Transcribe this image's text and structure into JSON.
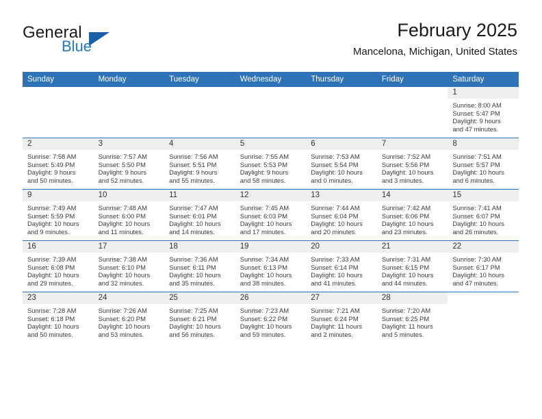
{
  "brand": {
    "name_part1": "General",
    "name_part2": "Blue",
    "logo_icon": "blue-triangle-icon"
  },
  "header": {
    "title": "February 2025",
    "location": "Mancelona, Michigan, United States"
  },
  "colors": {
    "header_blue": "#2E72B8",
    "daynum_band": "#EFEFEF",
    "brand_blue": "#2277C8",
    "separator": "#2E72B8"
  },
  "calendar": {
    "weekday_headers": [
      "Sunday",
      "Monday",
      "Tuesday",
      "Wednesday",
      "Thursday",
      "Friday",
      "Saturday"
    ],
    "weeks": [
      [
        {
          "day": "",
          "sunrise": "",
          "sunset": "",
          "daylight_line1": "",
          "daylight_line2": "",
          "empty": true
        },
        {
          "day": "",
          "sunrise": "",
          "sunset": "",
          "daylight_line1": "",
          "daylight_line2": "",
          "empty": true
        },
        {
          "day": "",
          "sunrise": "",
          "sunset": "",
          "daylight_line1": "",
          "daylight_line2": "",
          "empty": true
        },
        {
          "day": "",
          "sunrise": "",
          "sunset": "",
          "daylight_line1": "",
          "daylight_line2": "",
          "empty": true
        },
        {
          "day": "",
          "sunrise": "",
          "sunset": "",
          "daylight_line1": "",
          "daylight_line2": "",
          "empty": true
        },
        {
          "day": "",
          "sunrise": "",
          "sunset": "",
          "daylight_line1": "",
          "daylight_line2": "",
          "empty": true
        },
        {
          "day": "1",
          "sunrise": "Sunrise: 8:00 AM",
          "sunset": "Sunset: 5:47 PM",
          "daylight_line1": "Daylight: 9 hours",
          "daylight_line2": "and 47 minutes.",
          "empty": false
        }
      ],
      [
        {
          "day": "2",
          "sunrise": "Sunrise: 7:58 AM",
          "sunset": "Sunset: 5:49 PM",
          "daylight_line1": "Daylight: 9 hours",
          "daylight_line2": "and 50 minutes.",
          "empty": false
        },
        {
          "day": "3",
          "sunrise": "Sunrise: 7:57 AM",
          "sunset": "Sunset: 5:50 PM",
          "daylight_line1": "Daylight: 9 hours",
          "daylight_line2": "and 52 minutes.",
          "empty": false
        },
        {
          "day": "4",
          "sunrise": "Sunrise: 7:56 AM",
          "sunset": "Sunset: 5:51 PM",
          "daylight_line1": "Daylight: 9 hours",
          "daylight_line2": "and 55 minutes.",
          "empty": false
        },
        {
          "day": "5",
          "sunrise": "Sunrise: 7:55 AM",
          "sunset": "Sunset: 5:53 PM",
          "daylight_line1": "Daylight: 9 hours",
          "daylight_line2": "and 58 minutes.",
          "empty": false
        },
        {
          "day": "6",
          "sunrise": "Sunrise: 7:53 AM",
          "sunset": "Sunset: 5:54 PM",
          "daylight_line1": "Daylight: 10 hours",
          "daylight_line2": "and 0 minutes.",
          "empty": false
        },
        {
          "day": "7",
          "sunrise": "Sunrise: 7:52 AM",
          "sunset": "Sunset: 5:56 PM",
          "daylight_line1": "Daylight: 10 hours",
          "daylight_line2": "and 3 minutes.",
          "empty": false
        },
        {
          "day": "8",
          "sunrise": "Sunrise: 7:51 AM",
          "sunset": "Sunset: 5:57 PM",
          "daylight_line1": "Daylight: 10 hours",
          "daylight_line2": "and 6 minutes.",
          "empty": false
        }
      ],
      [
        {
          "day": "9",
          "sunrise": "Sunrise: 7:49 AM",
          "sunset": "Sunset: 5:59 PM",
          "daylight_line1": "Daylight: 10 hours",
          "daylight_line2": "and 9 minutes.",
          "empty": false
        },
        {
          "day": "10",
          "sunrise": "Sunrise: 7:48 AM",
          "sunset": "Sunset: 6:00 PM",
          "daylight_line1": "Daylight: 10 hours",
          "daylight_line2": "and 11 minutes.",
          "empty": false
        },
        {
          "day": "11",
          "sunrise": "Sunrise: 7:47 AM",
          "sunset": "Sunset: 6:01 PM",
          "daylight_line1": "Daylight: 10 hours",
          "daylight_line2": "and 14 minutes.",
          "empty": false
        },
        {
          "day": "12",
          "sunrise": "Sunrise: 7:45 AM",
          "sunset": "Sunset: 6:03 PM",
          "daylight_line1": "Daylight: 10 hours",
          "daylight_line2": "and 17 minutes.",
          "empty": false
        },
        {
          "day": "13",
          "sunrise": "Sunrise: 7:44 AM",
          "sunset": "Sunset: 6:04 PM",
          "daylight_line1": "Daylight: 10 hours",
          "daylight_line2": "and 20 minutes.",
          "empty": false
        },
        {
          "day": "14",
          "sunrise": "Sunrise: 7:42 AM",
          "sunset": "Sunset: 6:06 PM",
          "daylight_line1": "Daylight: 10 hours",
          "daylight_line2": "and 23 minutes.",
          "empty": false
        },
        {
          "day": "15",
          "sunrise": "Sunrise: 7:41 AM",
          "sunset": "Sunset: 6:07 PM",
          "daylight_line1": "Daylight: 10 hours",
          "daylight_line2": "and 26 minutes.",
          "empty": false
        }
      ],
      [
        {
          "day": "16",
          "sunrise": "Sunrise: 7:39 AM",
          "sunset": "Sunset: 6:08 PM",
          "daylight_line1": "Daylight: 10 hours",
          "daylight_line2": "and 29 minutes.",
          "empty": false
        },
        {
          "day": "17",
          "sunrise": "Sunrise: 7:38 AM",
          "sunset": "Sunset: 6:10 PM",
          "daylight_line1": "Daylight: 10 hours",
          "daylight_line2": "and 32 minutes.",
          "empty": false
        },
        {
          "day": "18",
          "sunrise": "Sunrise: 7:36 AM",
          "sunset": "Sunset: 6:11 PM",
          "daylight_line1": "Daylight: 10 hours",
          "daylight_line2": "and 35 minutes.",
          "empty": false
        },
        {
          "day": "19",
          "sunrise": "Sunrise: 7:34 AM",
          "sunset": "Sunset: 6:13 PM",
          "daylight_line1": "Daylight: 10 hours",
          "daylight_line2": "and 38 minutes.",
          "empty": false
        },
        {
          "day": "20",
          "sunrise": "Sunrise: 7:33 AM",
          "sunset": "Sunset: 6:14 PM",
          "daylight_line1": "Daylight: 10 hours",
          "daylight_line2": "and 41 minutes.",
          "empty": false
        },
        {
          "day": "21",
          "sunrise": "Sunrise: 7:31 AM",
          "sunset": "Sunset: 6:15 PM",
          "daylight_line1": "Daylight: 10 hours",
          "daylight_line2": "and 44 minutes.",
          "empty": false
        },
        {
          "day": "22",
          "sunrise": "Sunrise: 7:30 AM",
          "sunset": "Sunset: 6:17 PM",
          "daylight_line1": "Daylight: 10 hours",
          "daylight_line2": "and 47 minutes.",
          "empty": false
        }
      ],
      [
        {
          "day": "23",
          "sunrise": "Sunrise: 7:28 AM",
          "sunset": "Sunset: 6:18 PM",
          "daylight_line1": "Daylight: 10 hours",
          "daylight_line2": "and 50 minutes.",
          "empty": false
        },
        {
          "day": "24",
          "sunrise": "Sunrise: 7:26 AM",
          "sunset": "Sunset: 6:20 PM",
          "daylight_line1": "Daylight: 10 hours",
          "daylight_line2": "and 53 minutes.",
          "empty": false
        },
        {
          "day": "25",
          "sunrise": "Sunrise: 7:25 AM",
          "sunset": "Sunset: 6:21 PM",
          "daylight_line1": "Daylight: 10 hours",
          "daylight_line2": "and 56 minutes.",
          "empty": false
        },
        {
          "day": "26",
          "sunrise": "Sunrise: 7:23 AM",
          "sunset": "Sunset: 6:22 PM",
          "daylight_line1": "Daylight: 10 hours",
          "daylight_line2": "and 59 minutes.",
          "empty": false
        },
        {
          "day": "27",
          "sunrise": "Sunrise: 7:21 AM",
          "sunset": "Sunset: 6:24 PM",
          "daylight_line1": "Daylight: 11 hours",
          "daylight_line2": "and 2 minutes.",
          "empty": false
        },
        {
          "day": "28",
          "sunrise": "Sunrise: 7:20 AM",
          "sunset": "Sunset: 6:25 PM",
          "daylight_line1": "Daylight: 11 hours",
          "daylight_line2": "and 5 minutes.",
          "empty": false
        },
        {
          "day": "",
          "sunrise": "",
          "sunset": "",
          "daylight_line1": "",
          "daylight_line2": "",
          "empty": true
        }
      ]
    ]
  }
}
